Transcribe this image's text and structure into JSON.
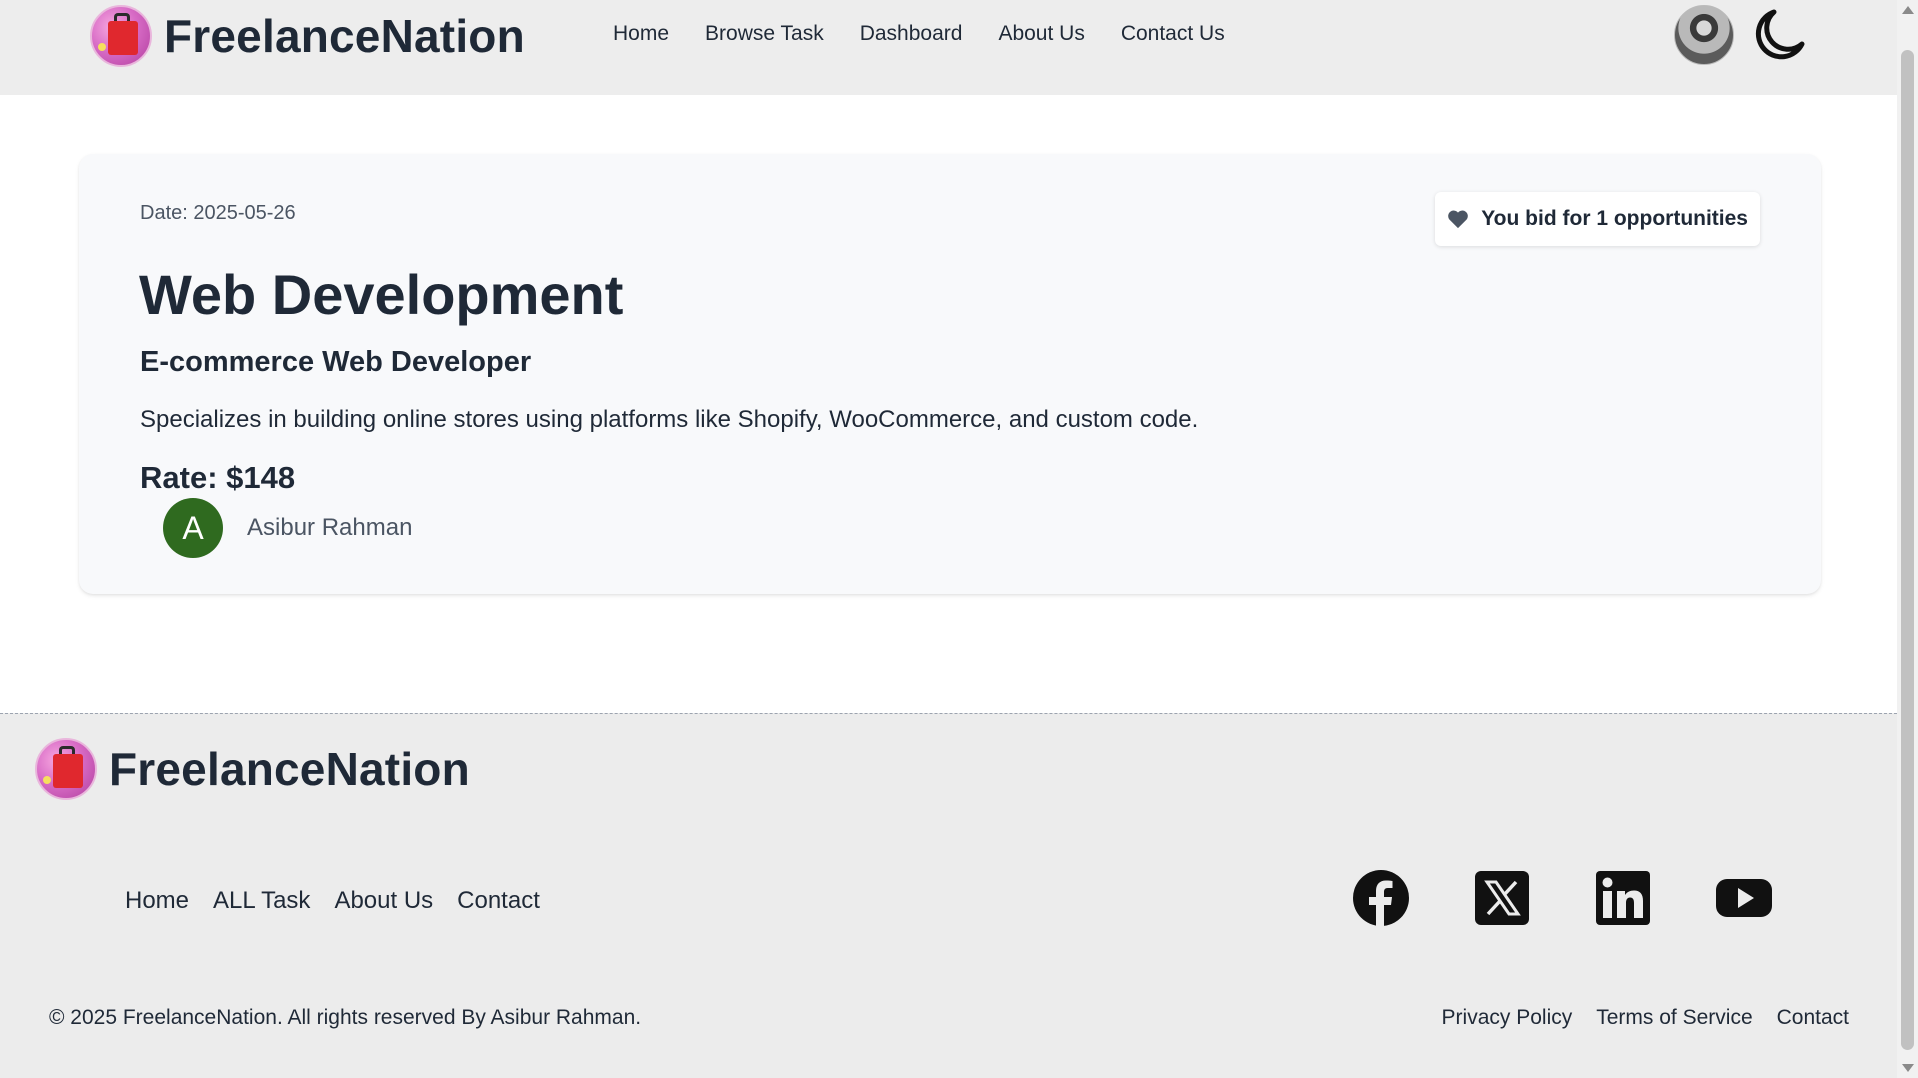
{
  "header": {
    "brand": "FreelanceNation",
    "nav": [
      "Home",
      "Browse Task",
      "Dashboard",
      "About Us",
      "Contact Us"
    ],
    "theme_icon": "moon-icon",
    "avatar_icon": "user-avatar"
  },
  "task": {
    "date": "Date: 2025-05-26",
    "bid_badge": "You bid for 1 opportunities",
    "bid_icon": "heart-icon",
    "category": "Web Development",
    "title": "E-commerce Web Developer",
    "description": "Specializes in building online stores using platforms like Shopify, WooCommerce, and custom code.",
    "rate": "Rate: $148",
    "owner_initial": "A",
    "owner_name": "Asibur Rahman"
  },
  "footer": {
    "brand": "FreelanceNation",
    "links": [
      "Home",
      "ALL Task",
      "About Us",
      "Contact"
    ],
    "socials": [
      "facebook-icon",
      "x-icon",
      "linkedin-icon",
      "youtube-icon"
    ],
    "copyright": "© 2025 FreelanceNation. All rights reserved By Asibur Rahman.",
    "legal": [
      "Privacy Policy",
      "Terms of Service",
      "Contact"
    ]
  },
  "colors": {
    "header_bg": "#ededed",
    "card_bg": "#f8f9fb",
    "owner_avatar": "#2f6a1f",
    "text": "#1f2937"
  }
}
